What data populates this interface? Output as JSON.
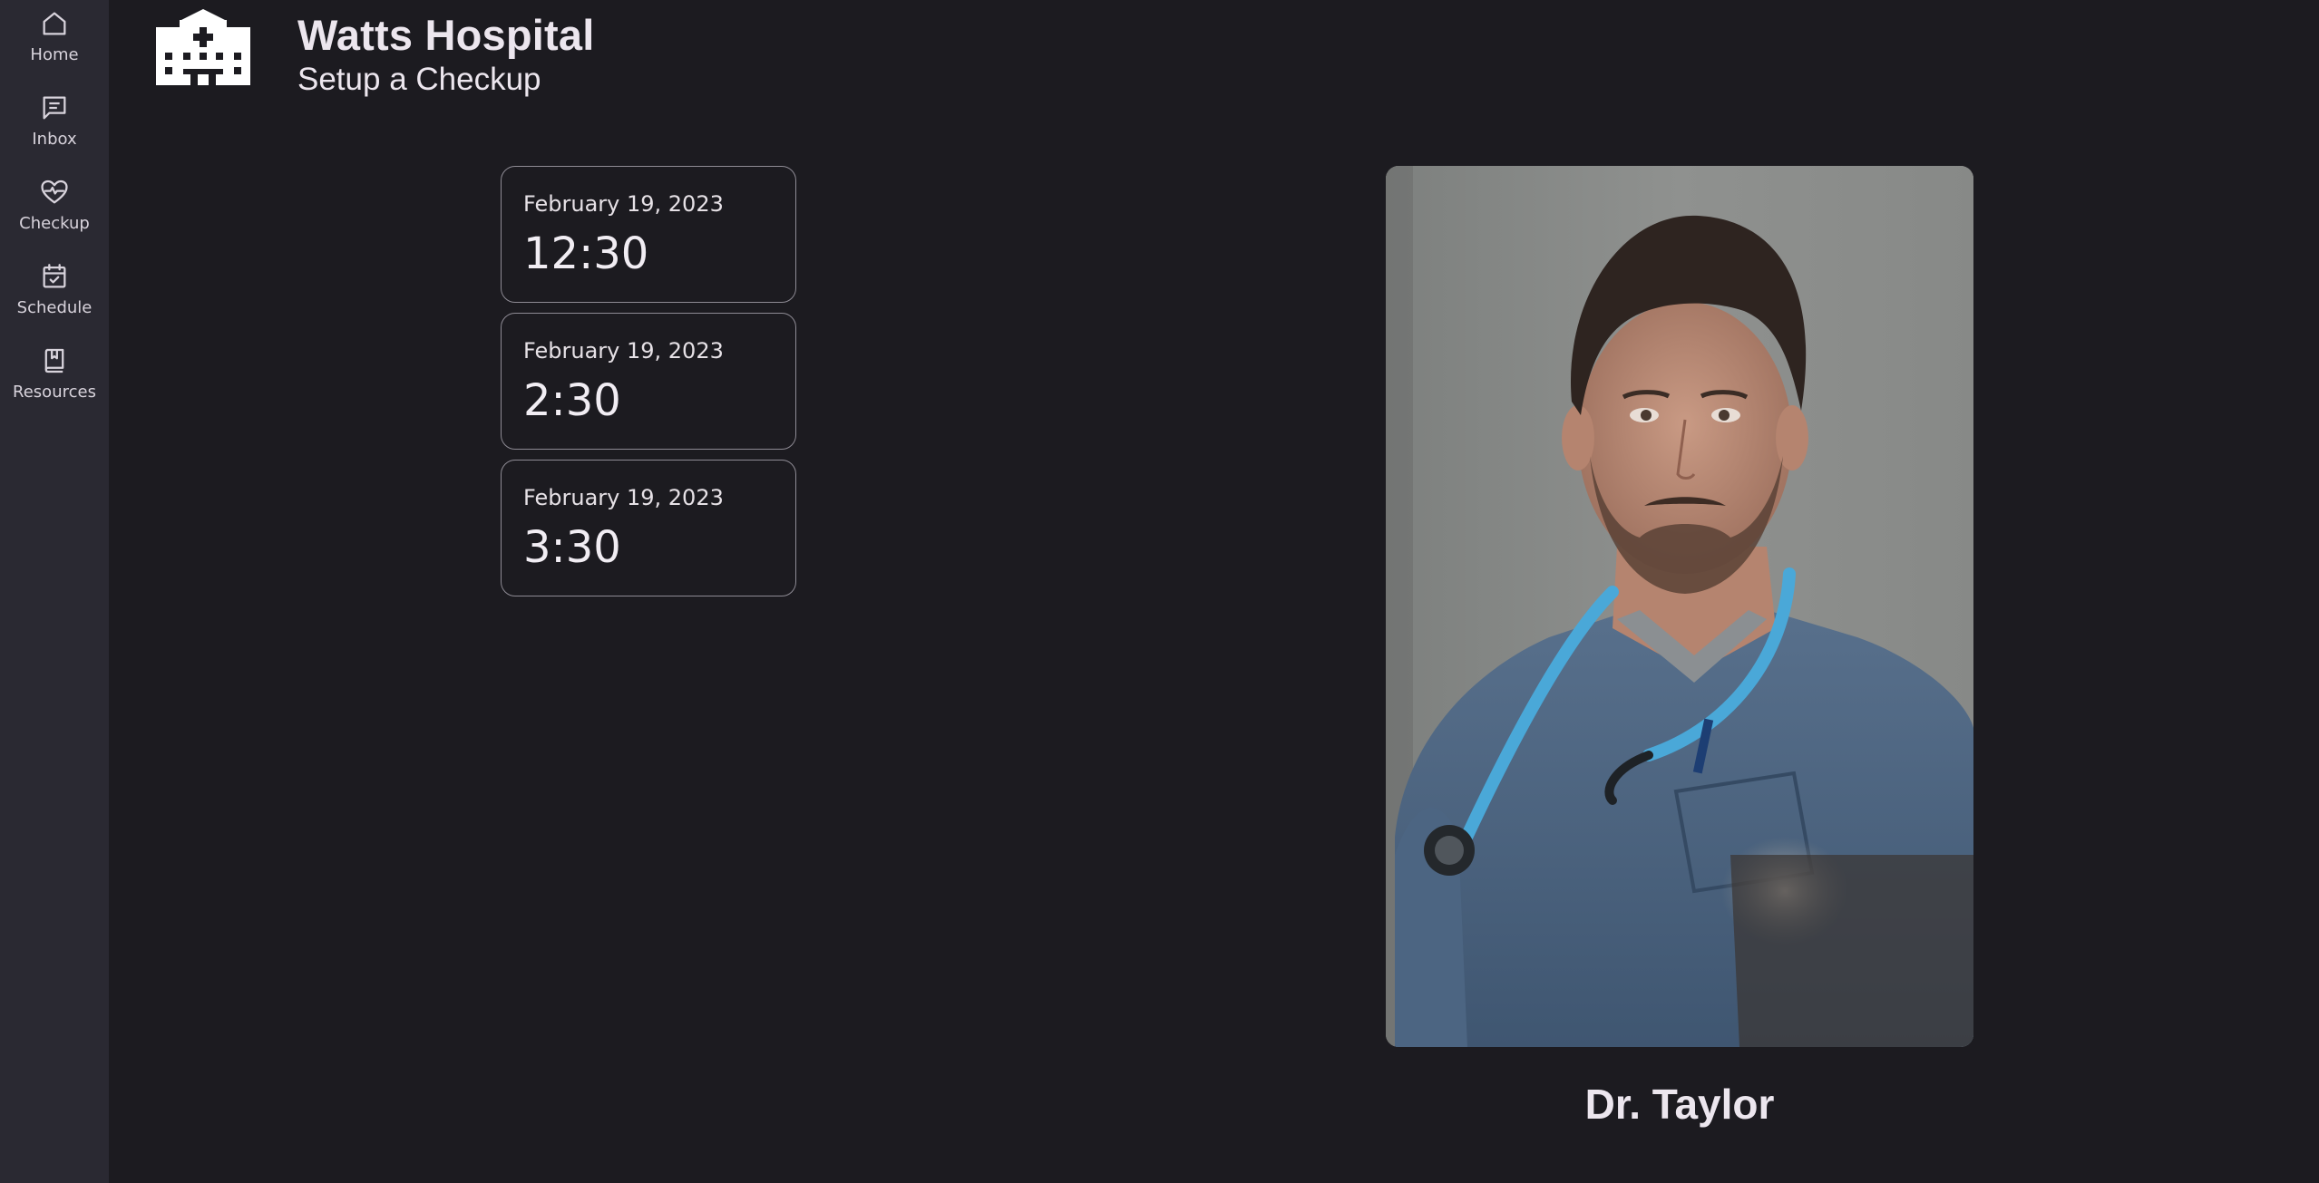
{
  "nav": {
    "items": [
      {
        "label": "Home",
        "icon": "home-icon"
      },
      {
        "label": "Inbox",
        "icon": "inbox-icon"
      },
      {
        "label": "Checkup",
        "icon": "heart-pulse-icon"
      },
      {
        "label": "Schedule",
        "icon": "calendar-check-icon"
      },
      {
        "label": "Resources",
        "icon": "book-icon"
      }
    ]
  },
  "header": {
    "logo_icon": "hospital-icon",
    "title": "Watts Hospital",
    "subtitle": "Setup a Checkup"
  },
  "appointments": [
    {
      "date": "February 19, 2023",
      "time": "12:30"
    },
    {
      "date": "February 19, 2023",
      "time": "2:30"
    },
    {
      "date": "February 19, 2023",
      "time": "3:30"
    }
  ],
  "doctor": {
    "name": "Dr. Taylor",
    "photo_icon": "doctor-photo"
  },
  "colors": {
    "background": "#1c1b20",
    "nav_background": "#2a2932",
    "text": "#e6e1e6",
    "card_border": "#8e8b94",
    "stethoscope": "#4aa8d8",
    "scrubs": "#4f6a88"
  }
}
